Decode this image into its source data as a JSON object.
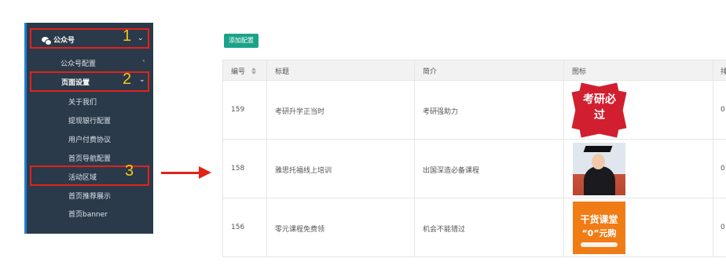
{
  "sidebar": {
    "top_item": "公众号",
    "items": [
      {
        "label": "公众号配置"
      },
      {
        "label": "页面设置"
      },
      {
        "label": "关于我们"
      },
      {
        "label": "提现银行配置"
      },
      {
        "label": "用户付费协议"
      },
      {
        "label": "首页导航配置"
      },
      {
        "label": "活动区域"
      },
      {
        "label": "首页推荐展示"
      },
      {
        "label": "首页banner"
      }
    ]
  },
  "annotations": {
    "n1": "1",
    "n2": "2",
    "n3": "3"
  },
  "toolbar": {
    "add_label": "添加配置"
  },
  "table": {
    "headers": [
      "编号",
      "标题",
      "简介",
      "图标",
      "排"
    ],
    "rows": [
      {
        "id": "159",
        "title": "考研升学正当时",
        "intro": "考研强助力",
        "icon_text": "考研必过",
        "order": "0"
      },
      {
        "id": "158",
        "title": "雅思托福线上培训",
        "intro": "出国深造必备课程",
        "icon_text": "",
        "order": "0"
      },
      {
        "id": "156",
        "title": "零元课程免费领",
        "intro": "机会不能错过",
        "icon_text_1": "干货课堂",
        "icon_text_2": "“0”元购",
        "order": "0"
      }
    ]
  },
  "colors": {
    "sidebar_bg": "#2b3a4a",
    "accent": "#1aa389",
    "annotation_red": "#e0231a",
    "annotation_yellow": "#f5c518"
  }
}
